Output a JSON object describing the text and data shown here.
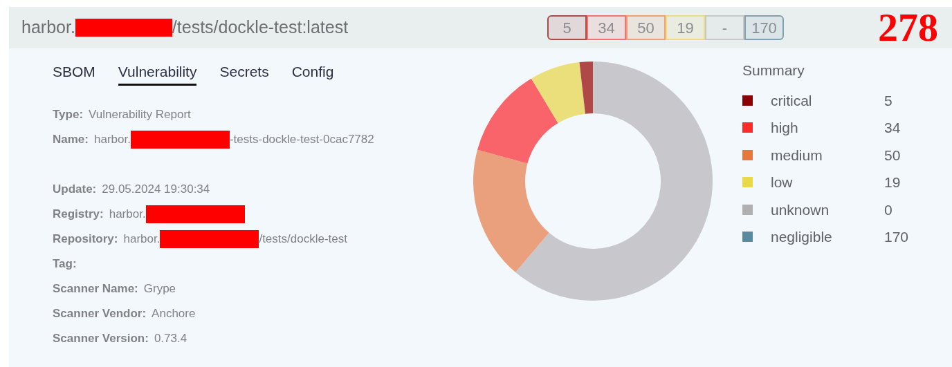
{
  "header": {
    "title_start": "harbor.",
    "title_redacted": true,
    "title_end": "/tests/dockle-test:latest",
    "badges": [
      {
        "text": "5",
        "color": "#b04848"
      },
      {
        "text": "34",
        "color": "#f87171"
      },
      {
        "text": "50",
        "color": "#f0a070"
      },
      {
        "text": "19",
        "color": "#eedd80"
      },
      {
        "text": "-",
        "color": "#c8c8cc"
      },
      {
        "text": "170",
        "color": "#7fa0b0"
      }
    ],
    "total": "278"
  },
  "tabs": [
    {
      "label": "SBOM",
      "selected": false
    },
    {
      "label": "Vulnerability",
      "selected": true
    },
    {
      "label": "Secrets",
      "selected": false
    },
    {
      "label": "Config",
      "selected": false
    }
  ],
  "fields": [
    {
      "kind": "field",
      "label": "Type:",
      "value_start": "Vulnerability Report"
    },
    {
      "kind": "field",
      "label": "Name:",
      "value_start": "harbor.",
      "redacted": true,
      "value_end": "-tests-dockle-test-0cac7782"
    },
    {
      "kind": "spacer"
    },
    {
      "kind": "field",
      "label": "Update:",
      "value_start": "29.05.2024 19:30:34"
    },
    {
      "kind": "field",
      "label": "Registry:",
      "value_start": "harbor.",
      "redacted": true
    },
    {
      "kind": "field",
      "label": "Repository:",
      "value_start": "harbor.",
      "redacted": true,
      "value_end": "/tests/dockle-test"
    },
    {
      "kind": "field",
      "label": "Tag:"
    },
    {
      "kind": "field",
      "label": "Scanner Name:",
      "value_start": "Grype"
    },
    {
      "kind": "field",
      "label": "Scanner Vendor:",
      "value_start": "Anchore"
    },
    {
      "kind": "field",
      "label": "Scanner Version:",
      "value_start": "0.73.4"
    }
  ],
  "chart_data": {
    "type": "donut",
    "values": [
      61.2,
      18.0,
      12.2,
      6.8,
      1.8
    ]
  },
  "summary": {
    "title": "Summary",
    "items": [
      {
        "label": "critical",
        "value": "5",
        "color": "#8b0000"
      },
      {
        "label": "high",
        "value": "34",
        "color": "#ff2a2a"
      },
      {
        "label": "medium",
        "value": "50",
        "color": "#e8773f"
      },
      {
        "label": "low",
        "value": "19",
        "color": "#e8d84a"
      },
      {
        "label": "unknown",
        "value": "0",
        "color": "#b0b0b0"
      },
      {
        "label": "negligible",
        "value": "170",
        "color": "#5b8aa0"
      }
    ]
  }
}
